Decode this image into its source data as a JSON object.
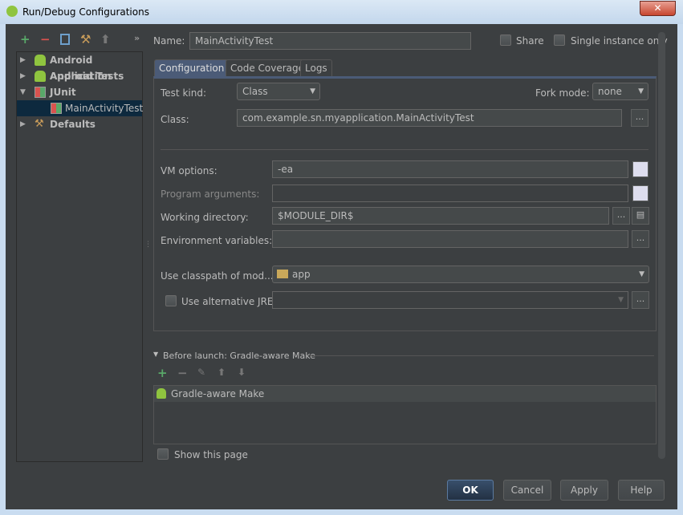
{
  "window": {
    "title": "Run/Debug Configurations",
    "close": "✕"
  },
  "toolbar": {
    "more": "»"
  },
  "tree": [
    {
      "label": "Android Application",
      "expanded": false
    },
    {
      "label": "Android Tests",
      "expanded": false
    },
    {
      "label": "JUnit",
      "expanded": true
    },
    {
      "label": "MainActivityTest",
      "selected": true
    },
    {
      "label": "Defaults",
      "expanded": false
    }
  ],
  "name": {
    "label": "Name:",
    "value": "MainActivityTest"
  },
  "share": {
    "label": "Share",
    "checked": false
  },
  "single": {
    "label": "Single instance only",
    "checked": false
  },
  "tabs": [
    "Configuration",
    "Code Coverage",
    "Logs"
  ],
  "form": {
    "test_kind_label": "Test kind:",
    "test_kind": "Class",
    "fork_label": "Fork mode:",
    "fork": "none",
    "class_label": "Class:",
    "class_value": "com.example.sn.myapplication.MainActivityTest",
    "vm_label": "VM options:",
    "vm_value": "-ea",
    "prog_label": "Program arguments:",
    "prog_value": "",
    "wd_label": "Working directory:",
    "wd_value": "$MODULE_DIR$",
    "env_label": "Environment variables:",
    "env_value": "",
    "cp_label": "Use classpath of mod...",
    "cp_value": "app",
    "jre_label": "Use alternative JRE:",
    "jre_checked": false,
    "ellipsis": "..."
  },
  "before_launch": {
    "title": "Before launch: Gradle-aware Make",
    "items": [
      "Gradle-aware Make"
    ]
  },
  "show_page": {
    "label": "Show this page",
    "checked": false
  },
  "buttons": {
    "ok": "OK",
    "cancel": "Cancel",
    "apply": "Apply",
    "help": "Help"
  }
}
